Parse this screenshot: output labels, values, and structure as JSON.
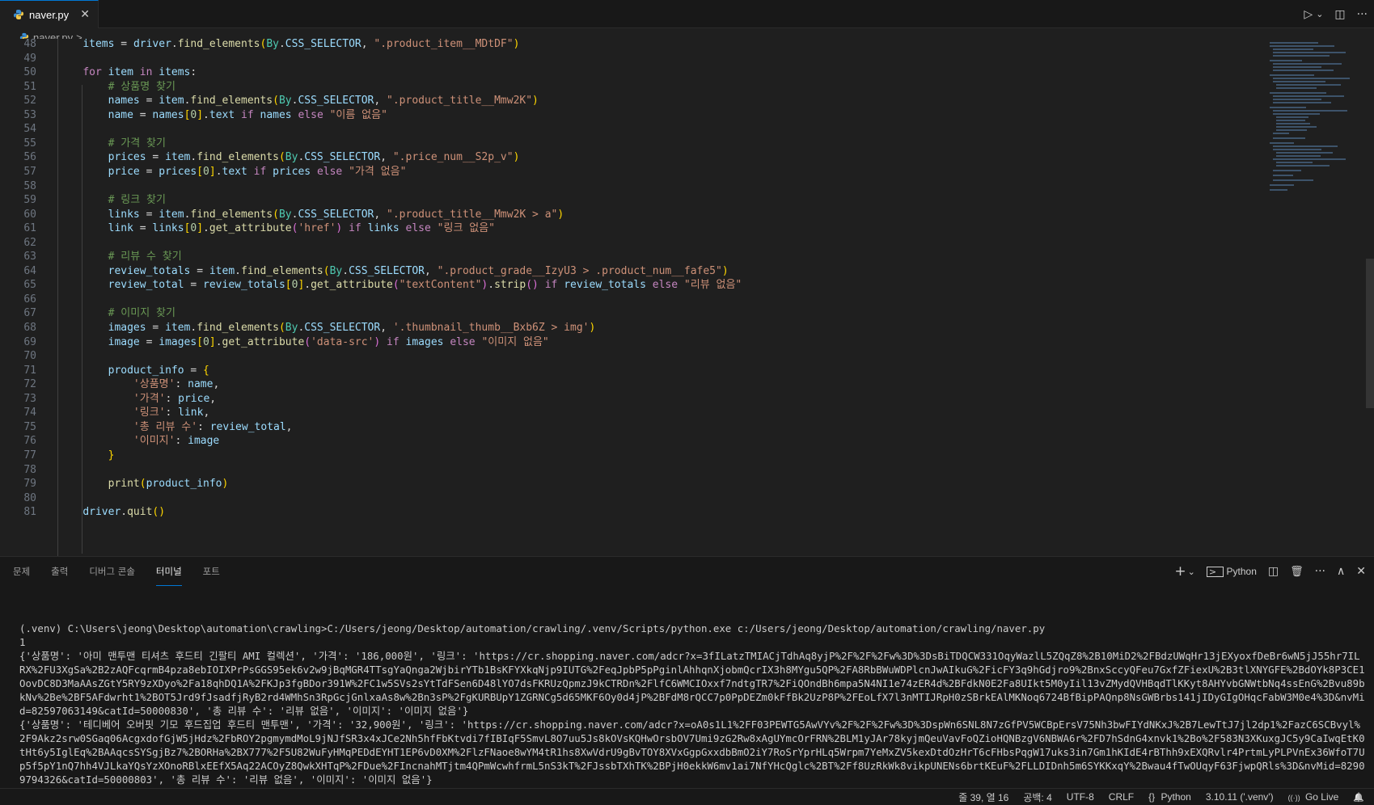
{
  "tab": {
    "filename": "naver.py",
    "close_glyph": "✕"
  },
  "tab_actions": {
    "run": "▷",
    "run_menu": "⌄",
    "split": "◫",
    "more": "···"
  },
  "breadcrumb": {
    "file": "naver.py",
    "sep": ">",
    "rest": "..."
  },
  "editor": {
    "lines": [
      {
        "n": "48",
        "t": [
          [
            "    ",
            "pun"
          ],
          [
            "items",
            "var"
          ],
          [
            " = ",
            "pun"
          ],
          [
            "driver",
            "var"
          ],
          [
            ".",
            "pun"
          ],
          [
            "find_elements",
            "fn"
          ],
          [
            "(",
            "br"
          ],
          [
            "By",
            "cls"
          ],
          [
            ".",
            "pun"
          ],
          [
            "CSS_SELECTOR",
            "var"
          ],
          [
            ", ",
            "pun"
          ],
          [
            "\".product_item__MDtDF\"",
            "str"
          ],
          [
            ")",
            "br"
          ]
        ]
      },
      {
        "n": "49",
        "t": []
      },
      {
        "n": "50",
        "t": [
          [
            "    ",
            "pun"
          ],
          [
            "for",
            "kw"
          ],
          [
            " ",
            "pun"
          ],
          [
            "item",
            "var"
          ],
          [
            " ",
            "pun"
          ],
          [
            "in",
            "kw"
          ],
          [
            " ",
            "pun"
          ],
          [
            "items",
            "var"
          ],
          [
            ":",
            "pun"
          ]
        ]
      },
      {
        "n": "51",
        "t": [
          [
            "        ",
            "pun"
          ],
          [
            "# 상품명 찾기",
            "com"
          ]
        ]
      },
      {
        "n": "52",
        "t": [
          [
            "        ",
            "pun"
          ],
          [
            "names",
            "var"
          ],
          [
            " = ",
            "pun"
          ],
          [
            "item",
            "var"
          ],
          [
            ".",
            "pun"
          ],
          [
            "find_elements",
            "fn"
          ],
          [
            "(",
            "br"
          ],
          [
            "By",
            "cls"
          ],
          [
            ".",
            "pun"
          ],
          [
            "CSS_SELECTOR",
            "var"
          ],
          [
            ", ",
            "pun"
          ],
          [
            "\".product_title__Mmw2K\"",
            "str"
          ],
          [
            ")",
            "br"
          ]
        ]
      },
      {
        "n": "53",
        "t": [
          [
            "        ",
            "pun"
          ],
          [
            "name",
            "var"
          ],
          [
            " = ",
            "pun"
          ],
          [
            "names",
            "var"
          ],
          [
            "[",
            "br"
          ],
          [
            "0",
            "num"
          ],
          [
            "]",
            "br"
          ],
          [
            ".",
            "pun"
          ],
          [
            "text",
            "var"
          ],
          [
            " ",
            "pun"
          ],
          [
            "if",
            "kw"
          ],
          [
            " ",
            "pun"
          ],
          [
            "names",
            "var"
          ],
          [
            " ",
            "pun"
          ],
          [
            "else",
            "kw"
          ],
          [
            " ",
            "pun"
          ],
          [
            "\"이름 없음\"",
            "str"
          ]
        ]
      },
      {
        "n": "54",
        "t": []
      },
      {
        "n": "55",
        "t": [
          [
            "        ",
            "pun"
          ],
          [
            "# 가격 찾기",
            "com"
          ]
        ]
      },
      {
        "n": "56",
        "t": [
          [
            "        ",
            "pun"
          ],
          [
            "prices",
            "var"
          ],
          [
            " = ",
            "pun"
          ],
          [
            "item",
            "var"
          ],
          [
            ".",
            "pun"
          ],
          [
            "find_elements",
            "fn"
          ],
          [
            "(",
            "br"
          ],
          [
            "By",
            "cls"
          ],
          [
            ".",
            "pun"
          ],
          [
            "CSS_SELECTOR",
            "var"
          ],
          [
            ", ",
            "pun"
          ],
          [
            "\".price_num__S2p_v\"",
            "str"
          ],
          [
            ")",
            "br"
          ]
        ]
      },
      {
        "n": "57",
        "t": [
          [
            "        ",
            "pun"
          ],
          [
            "price",
            "var"
          ],
          [
            " = ",
            "pun"
          ],
          [
            "prices",
            "var"
          ],
          [
            "[",
            "br"
          ],
          [
            "0",
            "num"
          ],
          [
            "]",
            "br"
          ],
          [
            ".",
            "pun"
          ],
          [
            "text",
            "var"
          ],
          [
            " ",
            "pun"
          ],
          [
            "if",
            "kw"
          ],
          [
            " ",
            "pun"
          ],
          [
            "prices",
            "var"
          ],
          [
            " ",
            "pun"
          ],
          [
            "else",
            "kw"
          ],
          [
            " ",
            "pun"
          ],
          [
            "\"가격 없음\"",
            "str"
          ]
        ]
      },
      {
        "n": "58",
        "t": []
      },
      {
        "n": "59",
        "t": [
          [
            "        ",
            "pun"
          ],
          [
            "# 링크 찾기",
            "com"
          ]
        ]
      },
      {
        "n": "60",
        "t": [
          [
            "        ",
            "pun"
          ],
          [
            "links",
            "var"
          ],
          [
            " = ",
            "pun"
          ],
          [
            "item",
            "var"
          ],
          [
            ".",
            "pun"
          ],
          [
            "find_elements",
            "fn"
          ],
          [
            "(",
            "br"
          ],
          [
            "By",
            "cls"
          ],
          [
            ".",
            "pun"
          ],
          [
            "CSS_SELECTOR",
            "var"
          ],
          [
            ", ",
            "pun"
          ],
          [
            "\".product_title__Mmw2K > a\"",
            "str"
          ],
          [
            ")",
            "br"
          ]
        ]
      },
      {
        "n": "61",
        "t": [
          [
            "        ",
            "pun"
          ],
          [
            "link",
            "var"
          ],
          [
            " = ",
            "pun"
          ],
          [
            "links",
            "var"
          ],
          [
            "[",
            "br"
          ],
          [
            "0",
            "num"
          ],
          [
            "]",
            "br"
          ],
          [
            ".",
            "pun"
          ],
          [
            "get_attribute",
            "fn"
          ],
          [
            "(",
            "br2"
          ],
          [
            "'href'",
            "str"
          ],
          [
            ")",
            "br2"
          ],
          [
            " ",
            "pun"
          ],
          [
            "if",
            "kw"
          ],
          [
            " ",
            "pun"
          ],
          [
            "links",
            "var"
          ],
          [
            " ",
            "pun"
          ],
          [
            "else",
            "kw"
          ],
          [
            " ",
            "pun"
          ],
          [
            "\"링크 없음\"",
            "str"
          ]
        ]
      },
      {
        "n": "62",
        "t": []
      },
      {
        "n": "63",
        "t": [
          [
            "        ",
            "pun"
          ],
          [
            "# 리뷰 수 찾기",
            "com"
          ]
        ]
      },
      {
        "n": "64",
        "t": [
          [
            "        ",
            "pun"
          ],
          [
            "review_totals",
            "var"
          ],
          [
            " = ",
            "pun"
          ],
          [
            "item",
            "var"
          ],
          [
            ".",
            "pun"
          ],
          [
            "find_elements",
            "fn"
          ],
          [
            "(",
            "br"
          ],
          [
            "By",
            "cls"
          ],
          [
            ".",
            "pun"
          ],
          [
            "CSS_SELECTOR",
            "var"
          ],
          [
            ", ",
            "pun"
          ],
          [
            "\".product_grade__IzyU3 > .product_num__fafe5\"",
            "str"
          ],
          [
            ")",
            "br"
          ]
        ]
      },
      {
        "n": "65",
        "t": [
          [
            "        ",
            "pun"
          ],
          [
            "review_total",
            "var"
          ],
          [
            " = ",
            "pun"
          ],
          [
            "review_totals",
            "var"
          ],
          [
            "[",
            "br"
          ],
          [
            "0",
            "num"
          ],
          [
            "]",
            "br"
          ],
          [
            ".",
            "pun"
          ],
          [
            "get_attribute",
            "fn"
          ],
          [
            "(",
            "br2"
          ],
          [
            "\"textContent\"",
            "str"
          ],
          [
            ")",
            "br2"
          ],
          [
            ".",
            "pun"
          ],
          [
            "strip",
            "fn"
          ],
          [
            "()",
            "br2"
          ],
          [
            " ",
            "pun"
          ],
          [
            "if",
            "kw"
          ],
          [
            " ",
            "pun"
          ],
          [
            "review_totals",
            "var"
          ],
          [
            " ",
            "pun"
          ],
          [
            "else",
            "kw"
          ],
          [
            " ",
            "pun"
          ],
          [
            "\"리뷰 없음\"",
            "str"
          ]
        ]
      },
      {
        "n": "66",
        "t": []
      },
      {
        "n": "67",
        "t": [
          [
            "        ",
            "pun"
          ],
          [
            "# 이미지 찾기",
            "com"
          ]
        ]
      },
      {
        "n": "68",
        "t": [
          [
            "        ",
            "pun"
          ],
          [
            "images",
            "var"
          ],
          [
            " = ",
            "pun"
          ],
          [
            "item",
            "var"
          ],
          [
            ".",
            "pun"
          ],
          [
            "find_elements",
            "fn"
          ],
          [
            "(",
            "br"
          ],
          [
            "By",
            "cls"
          ],
          [
            ".",
            "pun"
          ],
          [
            "CSS_SELECTOR",
            "var"
          ],
          [
            ", ",
            "pun"
          ],
          [
            "'.thumbnail_thumb__Bxb6Z > img'",
            "str"
          ],
          [
            ")",
            "br"
          ]
        ]
      },
      {
        "n": "69",
        "t": [
          [
            "        ",
            "pun"
          ],
          [
            "image",
            "var"
          ],
          [
            " = ",
            "pun"
          ],
          [
            "images",
            "var"
          ],
          [
            "[",
            "br"
          ],
          [
            "0",
            "num"
          ],
          [
            "]",
            "br"
          ],
          [
            ".",
            "pun"
          ],
          [
            "get_attribute",
            "fn"
          ],
          [
            "(",
            "br2"
          ],
          [
            "'data-src'",
            "str"
          ],
          [
            ")",
            "br2"
          ],
          [
            " ",
            "pun"
          ],
          [
            "if",
            "kw"
          ],
          [
            " ",
            "pun"
          ],
          [
            "images",
            "var"
          ],
          [
            " ",
            "pun"
          ],
          [
            "else",
            "kw"
          ],
          [
            " ",
            "pun"
          ],
          [
            "\"이미지 없음\"",
            "str"
          ]
        ]
      },
      {
        "n": "70",
        "t": []
      },
      {
        "n": "71",
        "t": [
          [
            "        ",
            "pun"
          ],
          [
            "product_info",
            "var"
          ],
          [
            " = ",
            "pun"
          ],
          [
            "{",
            "br"
          ]
        ]
      },
      {
        "n": "72",
        "t": [
          [
            "            ",
            "pun"
          ],
          [
            "'상품명'",
            "str"
          ],
          [
            ": ",
            "pun"
          ],
          [
            "name",
            "var"
          ],
          [
            ",",
            "pun"
          ]
        ]
      },
      {
        "n": "73",
        "t": [
          [
            "            ",
            "pun"
          ],
          [
            "'가격'",
            "str"
          ],
          [
            ": ",
            "pun"
          ],
          [
            "price",
            "var"
          ],
          [
            ",",
            "pun"
          ]
        ]
      },
      {
        "n": "74",
        "t": [
          [
            "            ",
            "pun"
          ],
          [
            "'링크'",
            "str"
          ],
          [
            ": ",
            "pun"
          ],
          [
            "link",
            "var"
          ],
          [
            ",",
            "pun"
          ]
        ]
      },
      {
        "n": "75",
        "t": [
          [
            "            ",
            "pun"
          ],
          [
            "'총 리뷰 수'",
            "str"
          ],
          [
            ": ",
            "pun"
          ],
          [
            "review_total",
            "var"
          ],
          [
            ",",
            "pun"
          ]
        ]
      },
      {
        "n": "76",
        "t": [
          [
            "            ",
            "pun"
          ],
          [
            "'이미지'",
            "str"
          ],
          [
            ": ",
            "pun"
          ],
          [
            "image",
            "var"
          ]
        ]
      },
      {
        "n": "77",
        "t": [
          [
            "        ",
            "pun"
          ],
          [
            "}",
            "br"
          ]
        ]
      },
      {
        "n": "78",
        "t": []
      },
      {
        "n": "79",
        "t": [
          [
            "        ",
            "pun"
          ],
          [
            "print",
            "fn"
          ],
          [
            "(",
            "br"
          ],
          [
            "product_info",
            "var"
          ],
          [
            ")",
            "br"
          ]
        ]
      },
      {
        "n": "80",
        "t": []
      },
      {
        "n": "81",
        "t": [
          [
            "    ",
            "pun"
          ],
          [
            "driver",
            "var"
          ],
          [
            ".",
            "pun"
          ],
          [
            "quit",
            "fn"
          ],
          [
            "()",
            "br"
          ]
        ]
      }
    ]
  },
  "panel": {
    "tabs": [
      "문제",
      "출력",
      "디버그 콘솔",
      "터미널",
      "포트"
    ],
    "active_tab": 3,
    "actions": {
      "add": "+",
      "add_menu": "⌄",
      "terminal_name": "Python",
      "split": "◫",
      "kill": "🗑",
      "more": "···",
      "maximize": "∧",
      "close": "✕"
    }
  },
  "terminal": {
    "lines": [
      "(.venv) C:\\Users\\jeong\\Desktop\\automation\\crawling>C:/Users/jeong/Desktop/automation/crawling/.venv/Scripts/python.exe c:/Users/jeong/Desktop/automation/crawling/naver.py",
      "1",
      "{'상품명': '아미 맨투맨 티셔츠 후드티 긴팔티 AMI 컬렉션', '가격': '186,000원', '링크': 'https://cr.shopping.naver.com/adcr?x=3fILatzTMIACjTdhAq8yjP%2F%2F%2Fw%3D%3DsBiTDQCW331OqyWazlL5ZQqZ8%2B10MiD2%2FBdzUWqHr13jEXyoxfDeBr6wN5jJ55hr7ILRX%2FU3XgSa%2B2zAQFcqrmB4pza8ebIOIXPrPsGGS95ek6v2w9jBqMGR4TTsgYaQnga2WjbirYTb1BsKFYXkqNjp9IUTG%2FeqJpbP5pPginlAhhqnXjobmQcrIX3h8MYgu5QP%2FA8RbBWuWDPlcnJwAIkuG%2FicFY3q9hGdjro9%2BnxSccyQFeu7GxfZFiexU%2B3tlXNYGFE%2BdOYk8P3CE1OovDC8D3MaAAsZGtY5RY9zXDyo%2Fa18qhDQ1A%2FKJp3fgBDor391W%2FC1w5SVs2sYtTdFSen6D48lYO7dsFKRUzQpmzJ9kCTRDn%2FlfC6WMCIOxxf7ndtgTR7%2FiQOndBh6mpa5N4NI1e74zER4d%2BFdkN0E2Fa8UIkt5M0yIil13vZMydQVHBqdTlKKyt8AHYvbGNWtbNq4ssEnG%2Bvu89bkNv%2Be%2BF5AFdwrht1%2BOT5Jrd9fJsadfjRyB2rd4WMhSn3RpGcjGnlxaAs8w%2Bn3sP%2FgKURBUpY1ZGRNCg5d65MKF6Oy0d4jP%2BFdM8rQCC7p0PpDEZm0kFfBk2UzP8P%2FEoLfX7l3nMTIJRpH0zSBrkEAlMKNoq6724BfBipPAQnp8NsGWBrbs141jIDyGIgOHqcFabW3M0e4%3D&nvMid=82597063149&catId=50000830', '총 리뷰 수': '리뷰 없음', '이미지': '이미지 없음'}",
      "{'상품명': '테디베어 오버핏 기모 후드집업 후드티 맨투맨', '가격': '32,900원', '링크': 'https://cr.shopping.naver.com/adcr?x=oA0s1L1%2FF03PEWTG5AwVYv%2F%2F%2Fw%3D%3DspWn6SNL8N7zGfPV5WCBpErsV75Nh3bwFIYdNKxJ%2B7LewTtJ7jl2dp1%2FazC6SCBvyl%2F9Akz2srw0SGaq06AcgxdofGjW5jHdz%2FbROY2pgmymdMoL9jNJfSR3x4xJCe2Nh5hfFbKtvdi7fIBIqF5SmvL8O7uu5Js8kOVsKQHwOrsbOV7Umi9zG2Rw8xAgUYmcOrFRN%2BLM1yJAr78kyjmQeuVavFoQZioHQNBzgV6NBWA6r%2FD7hSdnG4xnvk1%2Bo%2F583N3XKuxgJC5y9CaIwqEtK0tHt6y5IglEq%2BAAqcsSYSgjBz7%2BORHa%2BX777%2F5U82WuFyHMqPEDdEYHT1EP6vD0XM%2FlzFNaoe8wYM4tR1hs8XwVdrU9gBvTOY8XVxGgpGxxdbBmO2iY7RoSrYprHLq5Wrpm7YeMxZV5kexDtdOzHrT6cFHbsPqgW17uks3in7Gm1hKIdE4rBThh9xEXQRvlr4PrtmLyPLPVnEx36WfoT7Up5f5pY1nQ7hh4VJLkaYQsYzXOnoRBlxEEfX5Aq22ACOyZ8QwkXHTqP%2FDue%2FIncnahMTjtm4QPmWcwhfrmL5nS3kT%2FJssbTXhTK%2BPjH0ekkW6mv1ai7NfYHcQglc%2BT%2Ff8UzRkWk8vikpUNENs6brtKEuF%2FLLDIDnh5m6SYKKxqY%2Bwau4fTwOUqyF63FjwpQRls%3D&nvMid=82909794326&catId=50000803', '총 리뷰 수': '리뷰 없음', '이미지': '이미지 없음'}"
    ]
  },
  "status": {
    "cursor": "줄 39, 열 16",
    "spaces": "공백: 4",
    "encoding": "UTF-8",
    "eol": "CRLF",
    "language": "Python",
    "language_icon": "{}",
    "interpreter": "3.10.11 ('.venv')",
    "golive": "Go Live",
    "golive_icon": "((·))",
    "bell": "🔔"
  }
}
